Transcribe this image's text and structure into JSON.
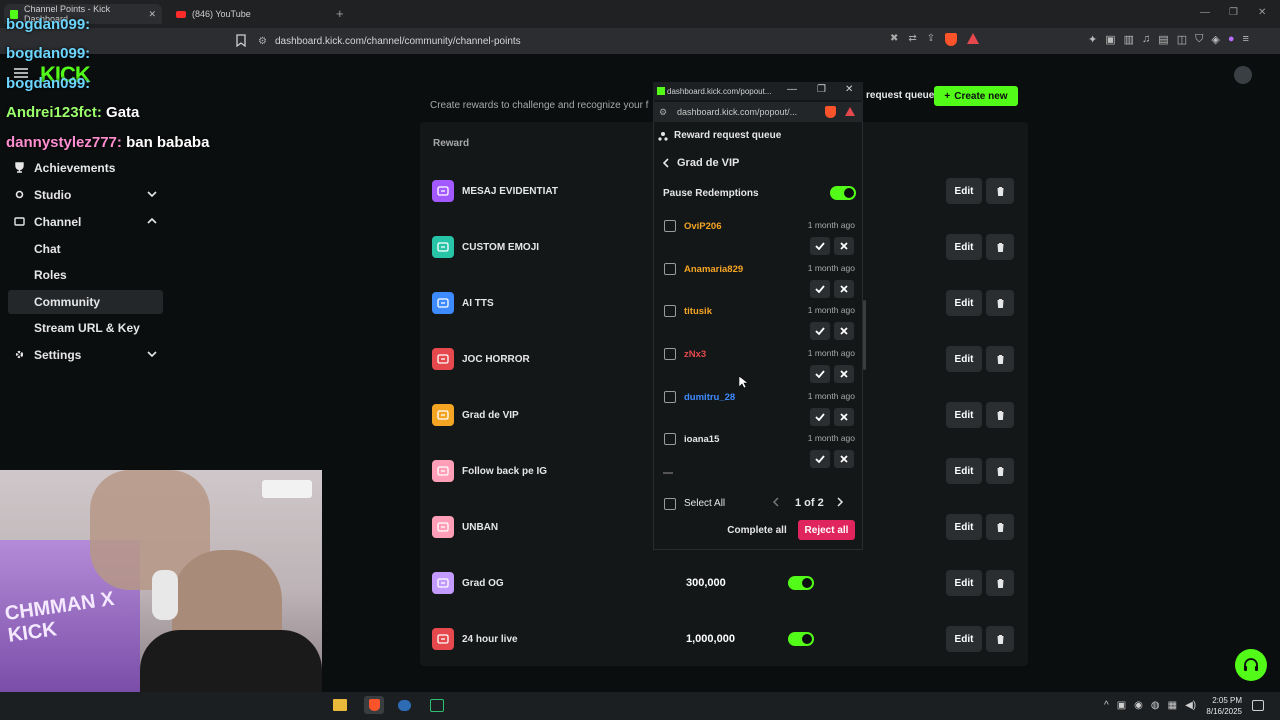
{
  "browser": {
    "tabs": [
      {
        "title": "Channel Points - Kick Dashboard",
        "active": true
      },
      {
        "title": "(846) YouTube",
        "active": false
      }
    ],
    "new_tab": "+",
    "url": "dashboard.kick.com/channel/community/channel-points"
  },
  "brand": {
    "logo": "KICK",
    "accent": "#53fc18"
  },
  "chat_overlay": [
    {
      "user": "bogdan099:",
      "text": "",
      "color": "#6cd6ff"
    },
    {
      "user": "bogdan099:",
      "text": "",
      "color": "#6cd6ff"
    },
    {
      "user": "bogdan099:",
      "text": "",
      "color": "#6cd6ff"
    },
    {
      "user": "Andrei123fct:",
      "text": "Gata",
      "color": "#9cff6c"
    },
    {
      "user": "dannystylez777:",
      "text": "ban bababa",
      "color": "#ff8fd1"
    }
  ],
  "sidebar": {
    "items": [
      {
        "label": "Achievements",
        "icon": "trophy-icon"
      },
      {
        "label": "Studio",
        "icon": "studio-icon",
        "chevron": "down"
      },
      {
        "label": "Channel",
        "icon": "channel-icon",
        "chevron": "up"
      },
      {
        "label": "Chat",
        "sub": true
      },
      {
        "label": "Roles",
        "sub": true
      },
      {
        "label": "Community",
        "sub": true,
        "active": true
      },
      {
        "label": "Stream URL & Key",
        "sub": true
      },
      {
        "label": "Settings",
        "icon": "gear-icon",
        "chevron": "down"
      }
    ]
  },
  "main": {
    "description": "Create rewards to challenge and recognize your f",
    "create_label": "Create new",
    "queue_label": "request queue",
    "column_reward": "Reward",
    "rewards": [
      {
        "name": "MESAJ EVIDENTIAT",
        "color": "#a259ff"
      },
      {
        "name": "CUSTOM EMOJI",
        "color": "#27c4a8"
      },
      {
        "name": "AI TTS",
        "color": "#3d8bff"
      },
      {
        "name": "JOC HORROR",
        "color": "#e5484d"
      },
      {
        "name": "Grad de VIP",
        "color": "#f5a524"
      },
      {
        "name": "Follow back pe IG",
        "color": "#ff9fb7"
      },
      {
        "name": "UNBAN",
        "color": "#ff9fb7"
      },
      {
        "name": "Grad OG",
        "color": "#c39bff",
        "cost": "300,000",
        "enabled": true
      },
      {
        "name": "24 hour live",
        "color": "#e5484d",
        "cost": "1,000,000",
        "enabled": true
      }
    ],
    "edit_label": "Edit"
  },
  "popout": {
    "window_title": "dashboard.kick.com/popout...",
    "url": "dashboard.kick.com/popout/...",
    "header": "Reward request queue",
    "back_title": "Grad de VIP",
    "pause_label": "Pause Redemptions",
    "pause_on": true,
    "redemptions": [
      {
        "user": "OviP206",
        "time": "1 month ago",
        "color": "#f5a524"
      },
      {
        "user": "Anamaria829",
        "time": "1 month ago",
        "color": "#f5a524"
      },
      {
        "user": "titusik",
        "time": "1 month ago",
        "color": "#f5a524"
      },
      {
        "user": "zNx3",
        "time": "1 month ago",
        "color": "#e5484d"
      },
      {
        "user": "dumitru_28",
        "time": "1 month ago",
        "color": "#3d8bff"
      },
      {
        "user": "ioana15",
        "time": "1 month ago",
        "color": "#e6e6e6"
      }
    ],
    "select_all": "Select All",
    "page": "1 of 2",
    "complete_all": "Complete all",
    "reject_all": "Reject all"
  },
  "webcam": {
    "sign_text": "CHMMAN X KICK"
  },
  "taskbar": {
    "time": "2:05 PM",
    "date": "8/16/2025"
  }
}
